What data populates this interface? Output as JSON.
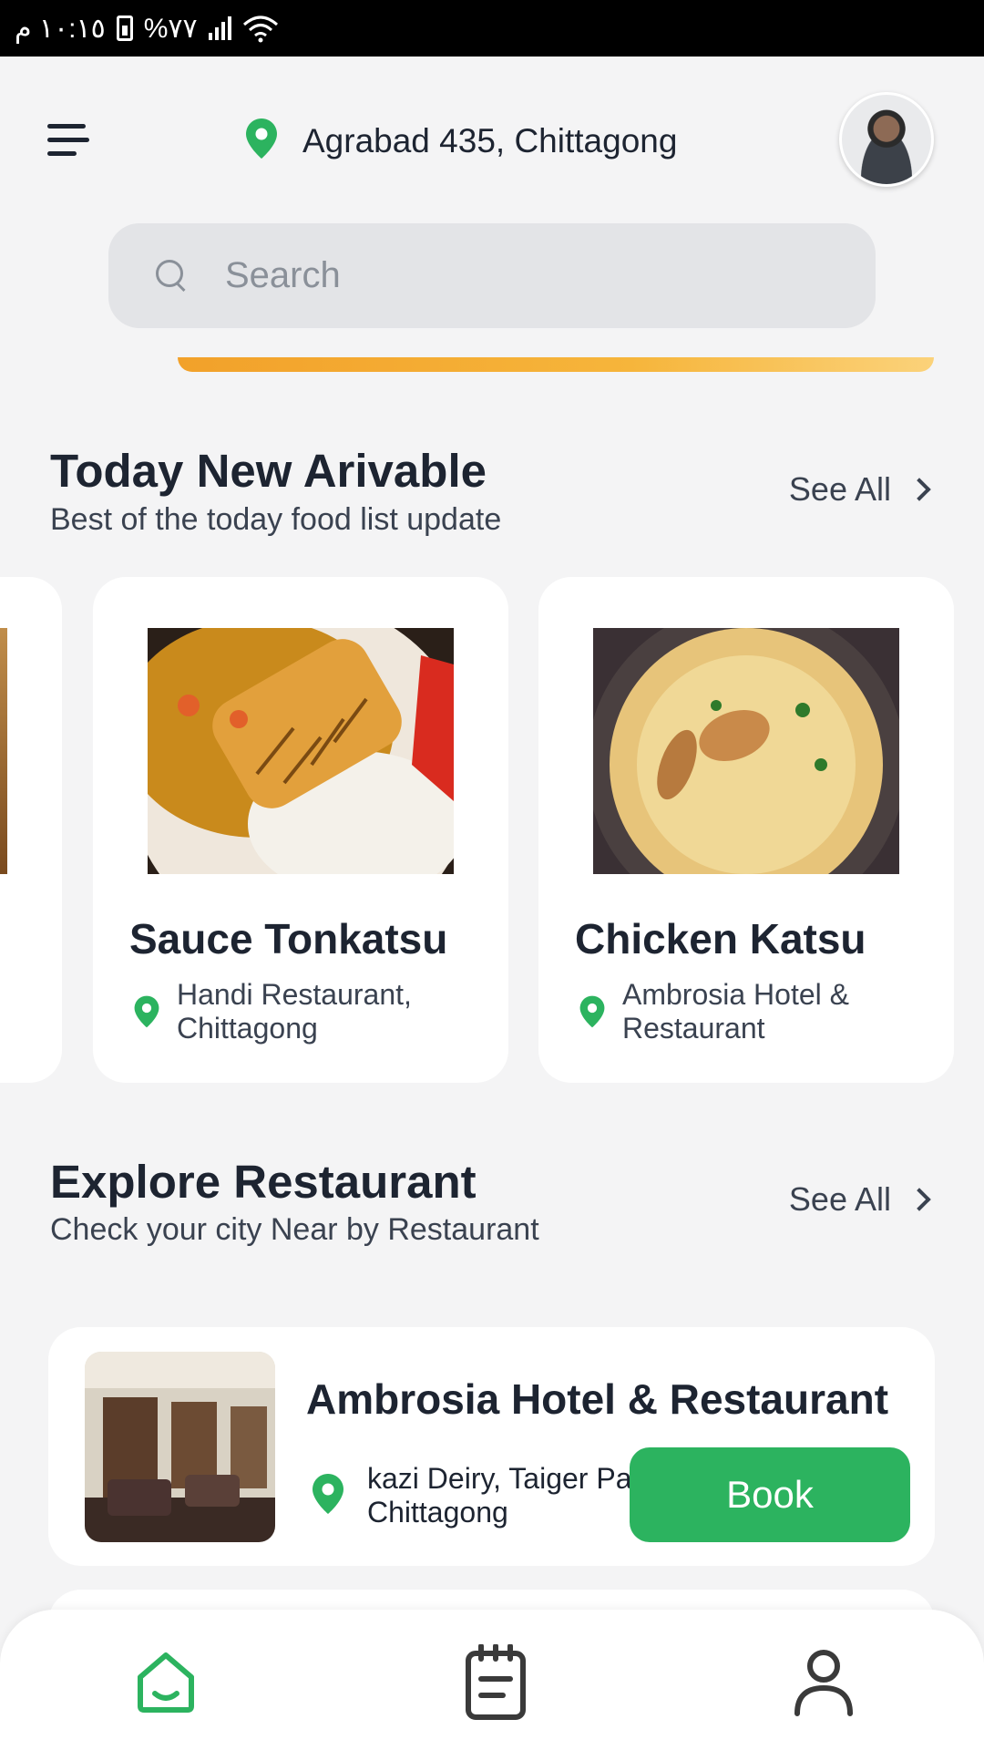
{
  "status_bar": {
    "time": "١٠:١٥ م",
    "battery": "%٧٧"
  },
  "header": {
    "location": "Agrabad 435, Chittagong"
  },
  "search": {
    "placeholder": "Search"
  },
  "today_section": {
    "title": "Today New Arivable",
    "subtitle": "Best of the today  food list update",
    "see_all": "See All"
  },
  "food_items": [
    {
      "name": "Sauce Tonkatsu",
      "location": "Handi Restaurant, Chittagong"
    },
    {
      "name": "Chicken Katsu",
      "location": "Ambrosia Hotel & Restaurant"
    }
  ],
  "explore_section": {
    "title": "Explore Restaurant",
    "subtitle": "Check your city Near by Restaurant",
    "see_all": "See All"
  },
  "restaurants": [
    {
      "name": "Ambrosia Hotel & Restaurant",
      "address_line1": "kazi Deiry, Taiger Pa",
      "address_line2": "Chittagong",
      "book_label": "Book"
    }
  ],
  "colors": {
    "accent": "#2cb35f",
    "text": "#1d2431",
    "background": "#f4f4f5",
    "promo": "#f6b53b"
  },
  "bottom_nav": {
    "active": "home",
    "items": [
      "home-icon",
      "orders-icon",
      "profile-icon"
    ]
  }
}
